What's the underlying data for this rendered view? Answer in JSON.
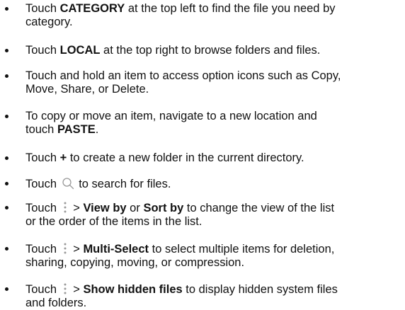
{
  "tips": [
    {
      "pre": "Touch ",
      "bold": "CATEGORY",
      "post": " at the top left to find the file you need by",
      "line2": "category."
    },
    {
      "pre": "Touch ",
      "bold": "LOCAL",
      "post": " at the top right to browse folders and files."
    },
    {
      "line1": "Touch and hold an item to access option icons such as Copy,",
      "line2": "Move, Share, or Delete."
    },
    {
      "line1": "To copy or move an item, navigate to a new location and",
      "pre2": "touch ",
      "bold2": "PASTE",
      "post2": "."
    },
    {
      "pre": "Touch ",
      "bold": "+",
      "post": " to create a new folder in the current directory."
    },
    {
      "pre": "Touch ",
      "icon": "search-icon",
      "post": " to search for files."
    },
    {
      "pre": "Touch ",
      "icon": "more-vertical-icon",
      "mid": " > ",
      "bold": "View by",
      "mid2": " or ",
      "bold2": "Sort by",
      "post": " to change the view of the list",
      "line2": "or the order of the items in the list."
    },
    {
      "pre": "Touch ",
      "icon": "more-vertical-icon",
      "mid": " > ",
      "bold": "Multi-Select",
      "post": " to select multiple items for deletion,",
      "line2": "sharing, copying, moving, or compression."
    },
    {
      "pre": "Touch ",
      "icon": "more-vertical-icon",
      "mid": " > ",
      "bold": "Show hidden files",
      "post": " to display hidden system files",
      "line2": "and folders."
    }
  ],
  "colors": {
    "text": "#111111",
    "icon": "#9a9a9a",
    "background": "#ffffff"
  }
}
